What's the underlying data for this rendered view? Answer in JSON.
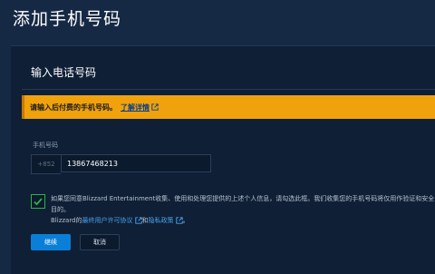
{
  "page": {
    "title": "添加手机号码"
  },
  "card": {
    "title": "输入电话号码"
  },
  "banner": {
    "text": "请输入后付费的手机号码。",
    "link": "了解详情",
    "link_icon": "external-link-icon"
  },
  "phone": {
    "label": "手机号码",
    "prefix": "+852",
    "value": "13867468213"
  },
  "consent": {
    "checked": true,
    "text_line1": "如果您同意Blizzard Entertainment收集、使用和处理您提供的上述个人信息，请勾选此框。我们收集您的手机号码将仅用作验证和安全目的。",
    "text_prefix": "Blizzard的",
    "eula_link": "最终用户许可协议",
    "and": "和",
    "privacy_link": "隐私政策",
    "end": "。"
  },
  "buttons": {
    "continue": "继续",
    "cancel": "取消"
  },
  "colors": {
    "background": "#162944",
    "banner": "#f0a20d",
    "primary": "#0a7fd8",
    "check": "#2fb34a",
    "link": "#4aa3f0"
  }
}
